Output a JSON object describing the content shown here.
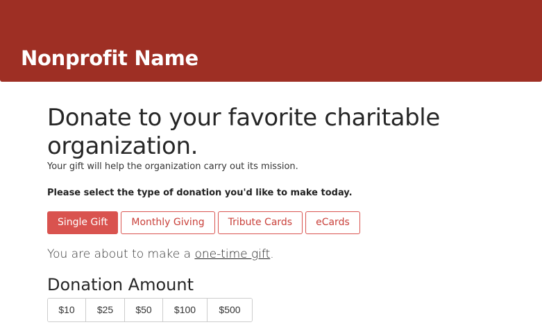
{
  "header": {
    "brand": "Nonprofit Name",
    "background_color": "#9e2f24"
  },
  "main": {
    "title": "Donate to your favorite charitable organization.",
    "subtitle": "Your gift will help the organization carry out its mission.",
    "prompt": "Please select the type of donation you'd like to make today.",
    "donation_types": [
      {
        "label": "Single Gift",
        "selected": true
      },
      {
        "label": "Monthly Giving",
        "selected": false
      },
      {
        "label": "Tribute Cards",
        "selected": false
      },
      {
        "label": "eCards",
        "selected": false
      }
    ],
    "about_prefix": "You are about to make a ",
    "about_link": "one-time gift",
    "about_suffix": ".",
    "amount_heading": "Donation Amount",
    "amounts": [
      "$10",
      "$25",
      "$50",
      "$100",
      "$500"
    ],
    "accent_color": "#d9534f"
  }
}
